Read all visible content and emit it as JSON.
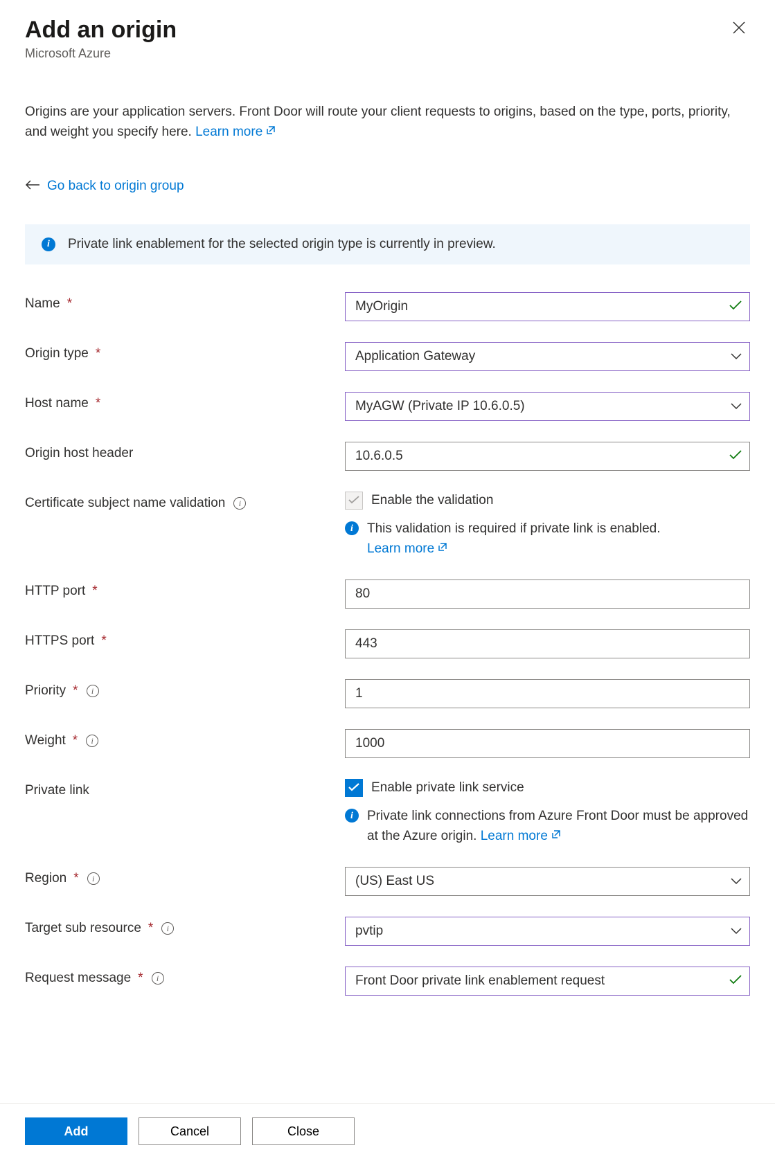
{
  "header": {
    "title": "Add an origin",
    "subtitle": "Microsoft Azure"
  },
  "description": {
    "text": "Origins are your application servers. Front Door will route your client requests to origins, based on the type, ports, priority, and weight you specify here. ",
    "learn_more": "Learn more"
  },
  "back_link": "Go back to origin group",
  "banner": "Private link enablement for the selected origin type is currently in preview.",
  "fields": {
    "name": {
      "label": "Name",
      "value": "MyOrigin"
    },
    "origin_type": {
      "label": "Origin type",
      "value": "Application Gateway"
    },
    "host_name": {
      "label": "Host name",
      "value": "MyAGW (Private IP 10.6.0.5)"
    },
    "host_header": {
      "label": "Origin host header",
      "value": "10.6.0.5"
    },
    "cert_validation": {
      "label": "Certificate subject name validation",
      "checkbox_label": "Enable the validation",
      "info_text": "This validation is required if private link is enabled. ",
      "learn_more": "Learn more"
    },
    "http_port": {
      "label": "HTTP port",
      "value": "80"
    },
    "https_port": {
      "label": "HTTPS port",
      "value": "443"
    },
    "priority": {
      "label": "Priority",
      "value": "1"
    },
    "weight": {
      "label": "Weight",
      "value": "1000"
    },
    "private_link": {
      "label": "Private link",
      "checkbox_label": "Enable private link service",
      "info_text": "Private link connections from Azure Front Door must be approved at the Azure origin. ",
      "learn_more": "Learn more"
    },
    "region": {
      "label": "Region",
      "value": "(US) East US"
    },
    "target_sub": {
      "label": "Target sub resource",
      "value": "pvtip"
    },
    "request_msg": {
      "label": "Request message",
      "value": "Front Door private link enablement request"
    }
  },
  "footer": {
    "add": "Add",
    "cancel": "Cancel",
    "close": "Close"
  }
}
